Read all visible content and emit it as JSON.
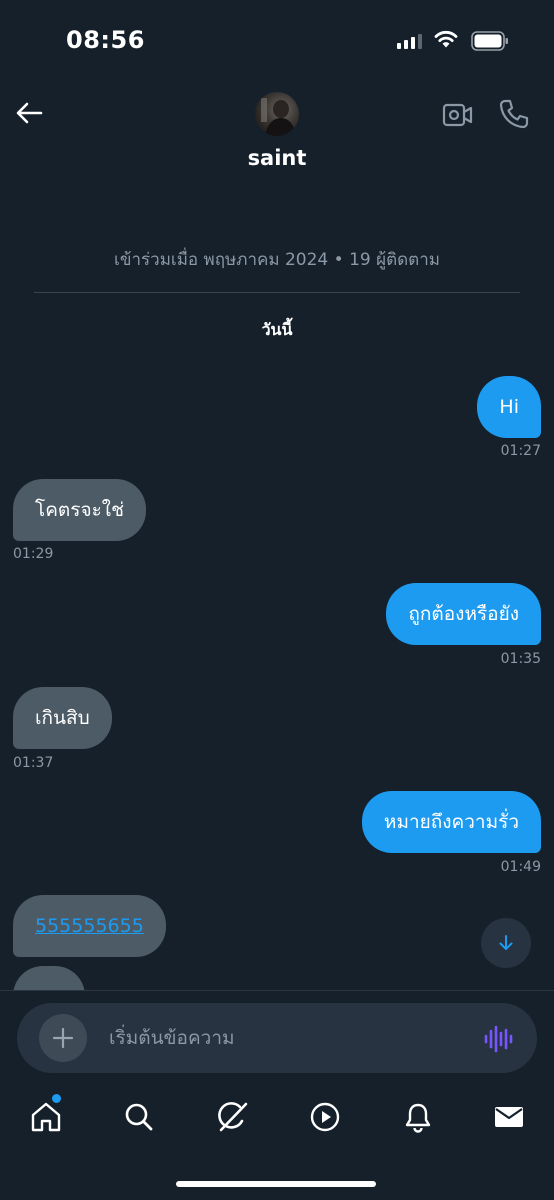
{
  "status_bar": {
    "time": "08:56"
  },
  "contact": {
    "name": "saint"
  },
  "profile_info": {
    "joined": "เข้าร่วมเมื่อ พฤษภาคม 2024 • 19 ผู้ติดตาม"
  },
  "day_label": "วันนี้",
  "messages": [
    {
      "text": "Hi",
      "time": "01:27",
      "direction": "outgoing"
    },
    {
      "text": "โคตรจะใช่",
      "time": "01:29",
      "direction": "incoming"
    },
    {
      "text": "ถูกต้องหรือยัง",
      "time": "01:35",
      "direction": "outgoing"
    },
    {
      "text": "เกินสิบ",
      "time": "01:37",
      "direction": "incoming"
    },
    {
      "text": "หมายถึงความรั่ว",
      "time": "01:49",
      "direction": "outgoing"
    },
    {
      "text": "555555655",
      "time": "",
      "direction": "incoming"
    },
    {
      "text": "",
      "time": "",
      "direction": "incoming"
    }
  ],
  "composer": {
    "placeholder": "เริ่มต้นข้อความ",
    "value": ""
  },
  "tabs": [
    "home-icon",
    "search-icon",
    "grok-icon",
    "video-icon",
    "notifications-icon",
    "messages-icon"
  ],
  "colors": {
    "background": "#15202b",
    "accent": "#1d9bf0",
    "incoming_bubble": "#4d5b67",
    "voice": "#7856ff"
  }
}
